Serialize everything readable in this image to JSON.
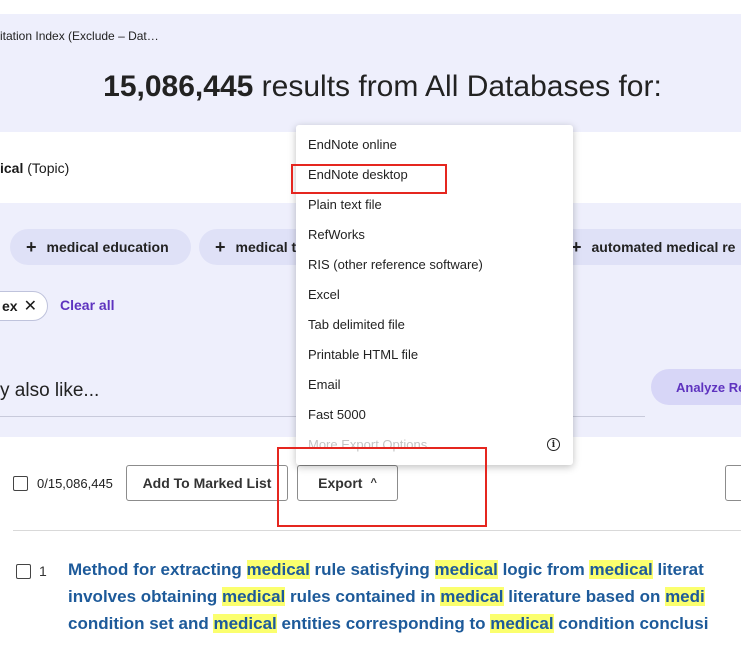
{
  "breadcrumb": "itation Index (Exclude – Dat…",
  "results": {
    "count": "15,086,445",
    "suffix": " results from All Databases for:"
  },
  "query": {
    "term": "ical",
    "field": " (Topic)"
  },
  "chips": [
    {
      "label": "medical education"
    },
    {
      "label": "medical t"
    },
    {
      "label": "automated medical re"
    }
  ],
  "filter_pill": {
    "label": "ex",
    "remove_icon": "✕"
  },
  "clear_all": "Clear all",
  "also_like": "y also like...",
  "analyze_button": "Analyze Re",
  "toolbar": {
    "selected_count": "0/15,086,445",
    "add_marked": "Add To Marked List",
    "export": "Export",
    "export_chevron": "^"
  },
  "export_menu": {
    "items": [
      "EndNote online",
      "EndNote desktop",
      "Plain text file",
      "RefWorks",
      "RIS (other reference software)",
      "Excel",
      "Tab delimited file",
      "Printable HTML file",
      "Email",
      "Fast 5000",
      "More Export Options"
    ],
    "info_icon": "i"
  },
  "result": {
    "number": "1",
    "lines": [
      [
        {
          "t": "Method for extracting ",
          "hl": false
        },
        {
          "t": "medical",
          "hl": true
        },
        {
          "t": " rule satisfying ",
          "hl": false
        },
        {
          "t": "medical",
          "hl": true
        },
        {
          "t": " logic from ",
          "hl": false
        },
        {
          "t": "medical",
          "hl": true
        },
        {
          "t": " literat",
          "hl": false
        }
      ],
      [
        {
          "t": "involves obtaining ",
          "hl": false
        },
        {
          "t": "medical",
          "hl": true
        },
        {
          "t": " rules contained in ",
          "hl": false
        },
        {
          "t": "medical",
          "hl": true
        },
        {
          "t": " literature based on ",
          "hl": false
        },
        {
          "t": "medi",
          "hl": true
        }
      ],
      [
        {
          "t": "condition set and ",
          "hl": false
        },
        {
          "t": "medical",
          "hl": true
        },
        {
          "t": " entities corresponding to ",
          "hl": false
        },
        {
          "t": "medical",
          "hl": true
        },
        {
          "t": " condition conclusi",
          "hl": false
        }
      ]
    ]
  },
  "colors": {
    "accent": "#5e33bf",
    "link": "#1d5a9a",
    "highlight": "#fbff6e",
    "annotation": "#e5261f",
    "band": "#eeeffc"
  }
}
